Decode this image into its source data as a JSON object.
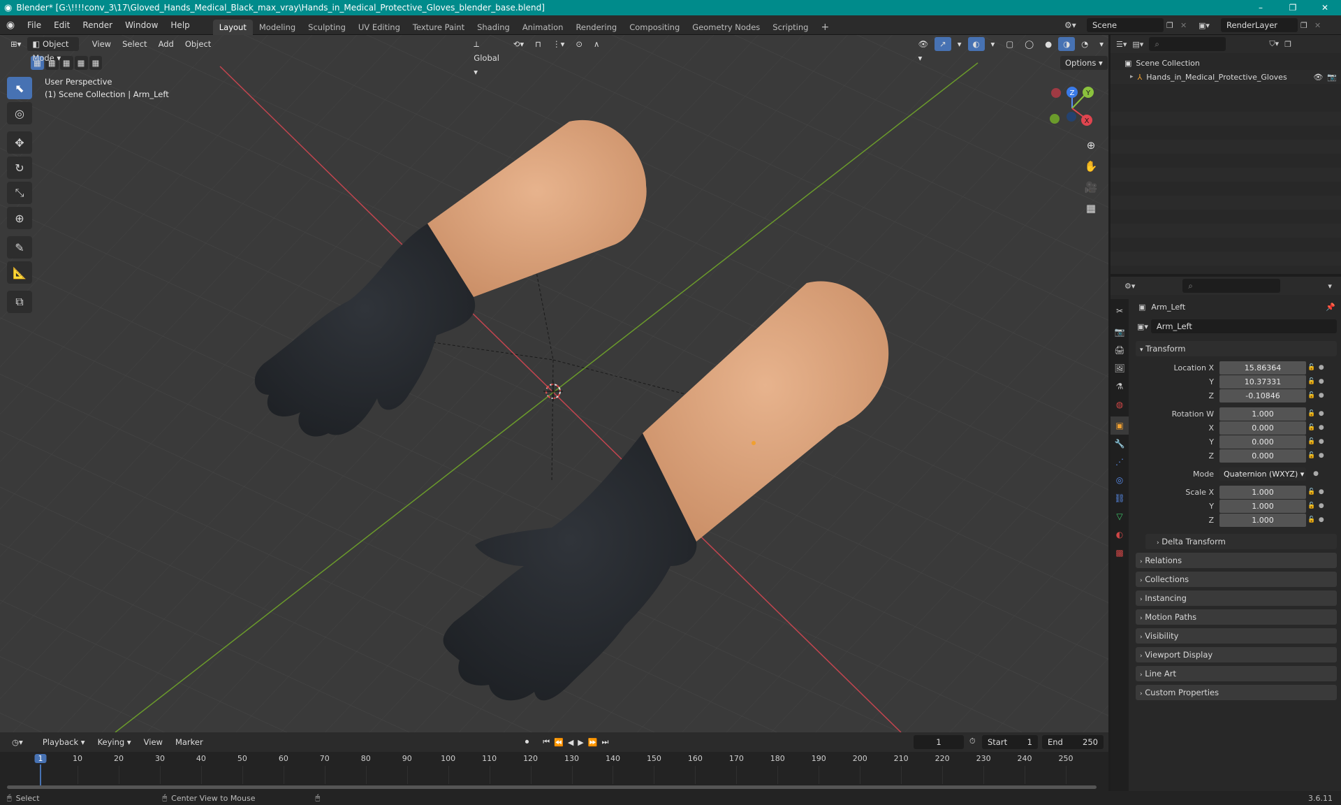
{
  "window": {
    "title": "Blender* [G:\\!!!!conv_3\\17\\Gloved_Hands_Medical_Black_max_vray\\Hands_in_Medical_Protective_Gloves_blender_base.blend]",
    "controls": [
      "–",
      "❐",
      "✕"
    ]
  },
  "menubar": {
    "menus": [
      "File",
      "Edit",
      "Render",
      "Window",
      "Help"
    ],
    "workspaces": [
      "Layout",
      "Modeling",
      "Sculpting",
      "UV Editing",
      "Texture Paint",
      "Shading",
      "Animation",
      "Rendering",
      "Compositing",
      "Geometry Nodes",
      "Scripting"
    ],
    "add_tab": "+",
    "scene": "Scene",
    "render_layer": "RenderLayer"
  },
  "viewport": {
    "mode": "Object Mode",
    "menus": [
      "View",
      "Select",
      "Add",
      "Object"
    ],
    "orientation": "Global",
    "options_label": "Options",
    "overlay_line1": "User Perspective",
    "overlay_line2": "(1) Scene Collection | Arm_Left",
    "gizmo_axes": {
      "z": "Z",
      "y": "Y",
      "x": "X"
    }
  },
  "outliner": {
    "root": "Scene Collection",
    "items": [
      {
        "name": "Hands_in_Medical_Protective_Gloves"
      }
    ]
  },
  "properties": {
    "object_name": "Arm_Left",
    "data_name": "Arm_Left",
    "transform_title": "Transform",
    "location": {
      "label_x": "Location X",
      "x": "15.86364",
      "y": "10.37331",
      "z": "-0.10846"
    },
    "rotation": {
      "label_w": "Rotation W",
      "w": "1.000",
      "x": "0.000",
      "y": "0.000",
      "z": "0.000"
    },
    "mode_label": "Mode",
    "mode_value": "Quaternion (WXYZ)",
    "scale": {
      "label_x": "Scale X",
      "x": "1.000",
      "y": "1.000",
      "z": "1.000"
    },
    "axis_labels": {
      "x": "X",
      "y": "Y",
      "z": "Z"
    },
    "delta": "Delta Transform",
    "panels": [
      "Relations",
      "Collections",
      "Instancing",
      "Motion Paths",
      "Visibility",
      "Viewport Display",
      "Line Art",
      "Custom Properties"
    ]
  },
  "timeline": {
    "menus": [
      "Playback",
      "Keying",
      "View",
      "Marker"
    ],
    "current_frame": "1",
    "start_label": "Start",
    "start": "1",
    "end_label": "End",
    "end": "250",
    "ticks": [
      "1",
      "10",
      "20",
      "30",
      "40",
      "50",
      "60",
      "70",
      "80",
      "90",
      "100",
      "110",
      "120",
      "130",
      "140",
      "150",
      "160",
      "170",
      "180",
      "190",
      "200",
      "210",
      "220",
      "230",
      "240",
      "250"
    ]
  },
  "statusbar": {
    "select": "Select",
    "center": "Center View to Mouse",
    "version": "3.6.11"
  }
}
